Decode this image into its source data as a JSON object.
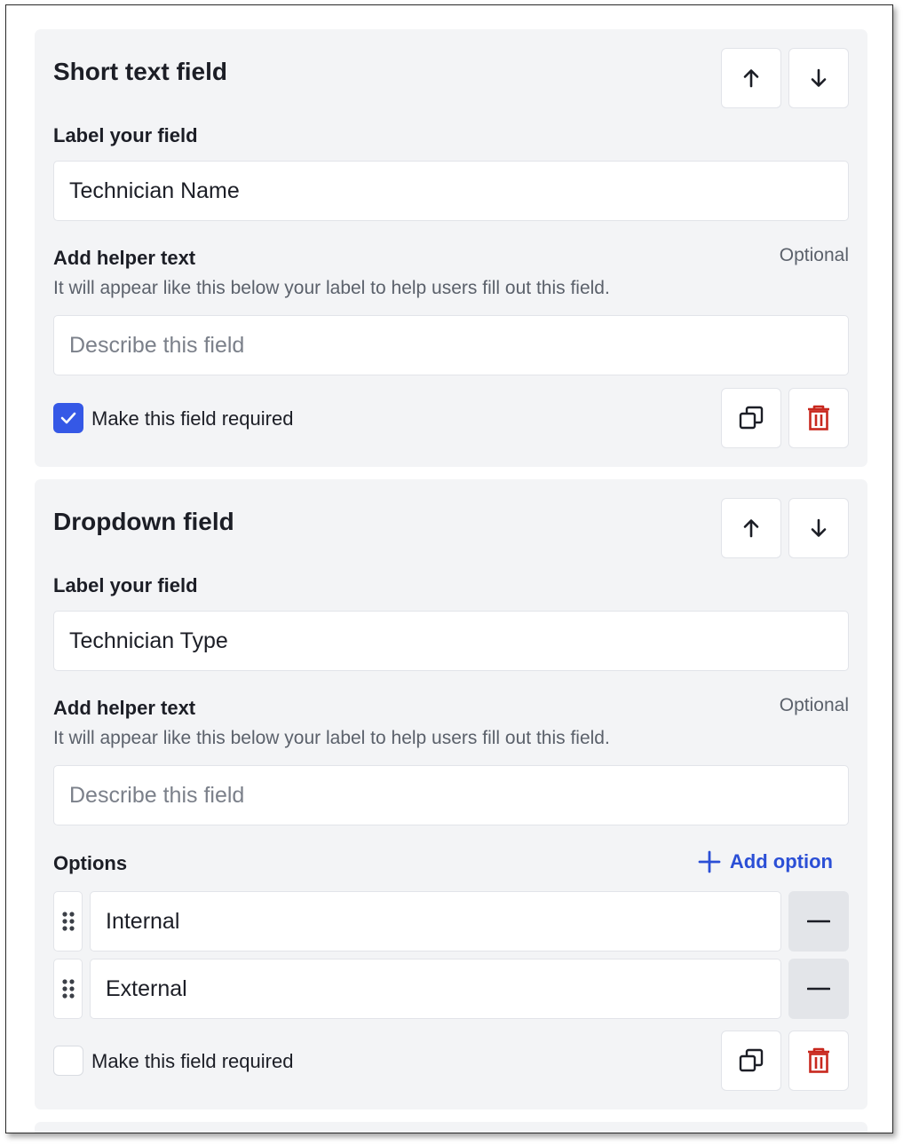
{
  "cards": [
    {
      "title": "Short text field",
      "label_heading": "Label your field",
      "label_value": "Technician Name",
      "helper_heading": "Add helper text",
      "optional": "Optional",
      "helper_description": "It will appear like this below your label to help users fill out this field.",
      "helper_placeholder": "Describe this field",
      "required_label": "Make this field required",
      "required_checked": true
    },
    {
      "title": "Dropdown field",
      "label_heading": "Label your field",
      "label_value": "Technician Type",
      "helper_heading": "Add helper text",
      "optional": "Optional",
      "helper_description": "It will appear like this below your label to help users fill out this field.",
      "helper_placeholder": "Describe this field",
      "options_heading": "Options",
      "add_option_label": "Add option",
      "options": [
        "Internal",
        "External"
      ],
      "required_label": "Make this field required",
      "required_checked": false
    }
  ],
  "icons": {
    "move_up": "arrow-up-icon",
    "move_down": "arrow-down-icon",
    "duplicate": "copy-icon",
    "delete": "trash-icon",
    "drag": "drag-handle-icon",
    "remove_option": "minus-icon",
    "add": "plus-icon",
    "check": "check-icon"
  },
  "colors": {
    "accent": "#3558e6",
    "link": "#2b4fd6",
    "danger": "#c8281e",
    "card_bg": "#f3f4f6"
  }
}
